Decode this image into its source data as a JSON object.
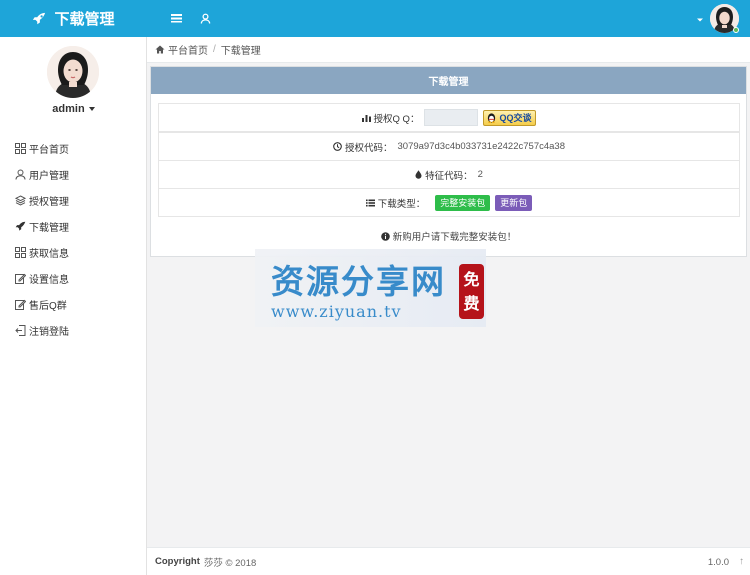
{
  "app": {
    "title": "下载管理"
  },
  "topbar": {
    "nav_icons": [
      "menu-icon",
      "user-icon"
    ]
  },
  "sidebar": {
    "username": "admin",
    "items": [
      {
        "label": "平台首页",
        "icon": "grid-icon"
      },
      {
        "label": "用户管理",
        "icon": "user-icon"
      },
      {
        "label": "授权管理",
        "icon": "layers-icon"
      },
      {
        "label": "下载管理",
        "icon": "rocket-icon"
      },
      {
        "label": "获取信息",
        "icon": "grid-icon"
      },
      {
        "label": "设置信息",
        "icon": "edit-icon"
      },
      {
        "label": "售后Q群",
        "icon": "edit-icon"
      },
      {
        "label": "注销登陆",
        "icon": "logout-icon"
      }
    ]
  },
  "breadcrumb": {
    "home": "平台首页",
    "separator": "/",
    "current": "下载管理"
  },
  "panel": {
    "title": "下载管理",
    "qq": {
      "label": "授权Q Q：",
      "value": "",
      "button": "QQ交谈"
    },
    "auth_code": {
      "label": "授权代码：",
      "value": "3079a97d3c4b033731e2422c757c4a38"
    },
    "feature_code": {
      "label": "特征代码：",
      "value": "2"
    },
    "download_type": {
      "label": "下载类型：",
      "full_package": "完整安装包",
      "update_package": "更新包"
    },
    "notice": "新购用户请下载完整安装包！"
  },
  "watermark": {
    "text": "资源分享网",
    "url": "www.ziyuan.tv",
    "seal": [
      "免",
      "费"
    ]
  },
  "footer": {
    "copyright_label": "Copyright",
    "copyright_text": "莎莎 © 2018",
    "version": "1.0.0",
    "up_icon": "↑"
  },
  "colors": {
    "topbar": "#1ea5d9",
    "panel_header": "#8aa6c1",
    "full_package": "#2ebd4a",
    "update_package": "#7b5cb8",
    "seal": "#b5131a"
  }
}
